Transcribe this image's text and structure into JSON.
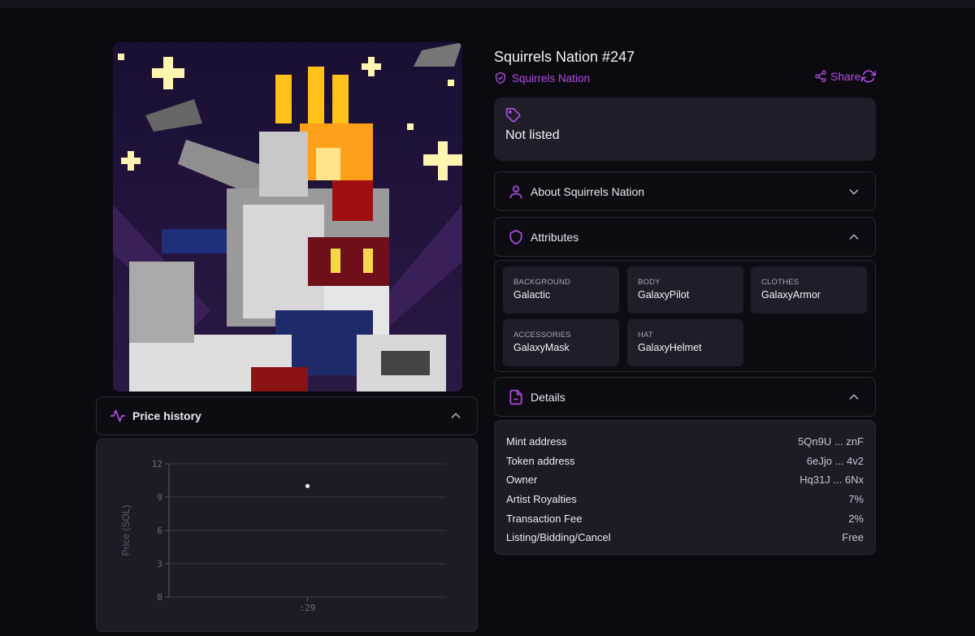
{
  "nft": {
    "title": "Squirrels Nation #247",
    "collection": "Squirrels Nation",
    "share_label": "Share"
  },
  "listing": {
    "status": "Not listed"
  },
  "sections": {
    "about": "About Squirrels Nation",
    "attributes": "Attributes",
    "details": "Details",
    "price_history": "Price history"
  },
  "attributes": [
    {
      "key": "BACKGROUND",
      "value": "Galactic"
    },
    {
      "key": "BODY",
      "value": "GalaxyPilot"
    },
    {
      "key": "CLOTHES",
      "value": "GalaxyArmor"
    },
    {
      "key": "ACCESSORIES",
      "value": "GalaxyMask"
    },
    {
      "key": "HAT",
      "value": "GalaxyHelmet"
    }
  ],
  "details": [
    {
      "key": "Mint address",
      "value": "5Qn9U ... znF"
    },
    {
      "key": "Token address",
      "value": "6eJjo ... 4v2"
    },
    {
      "key": "Owner",
      "value": "Hq31J ... 6Nx"
    },
    {
      "key": "Artist Royalties",
      "value": "7%"
    },
    {
      "key": "Transaction Fee",
      "value": "2%"
    },
    {
      "key": "Listing/Bidding/Cancel",
      "value": "Free"
    }
  ],
  "colors": {
    "accent": "#b34fe6",
    "panel": "#1f1d29",
    "background": "#0b0a10"
  },
  "icons": {
    "collection": "verified-shield-icon",
    "share": "share-icon",
    "refresh": "refresh-icon",
    "listing": "tag-icon",
    "about": "user-icon",
    "attributes": "shield-icon",
    "details": "document-icon",
    "price_history": "activity-icon"
  },
  "chart_data": {
    "type": "scatter",
    "title": "",
    "xlabel": "",
    "ylabel": "Price (SOL)",
    "ylim": [
      0,
      12
    ],
    "yticks": [
      "0",
      "3",
      "6",
      "9",
      "12"
    ],
    "xticks": [
      ":29"
    ],
    "x": [
      ":29"
    ],
    "y": [
      10
    ],
    "grid": true
  }
}
